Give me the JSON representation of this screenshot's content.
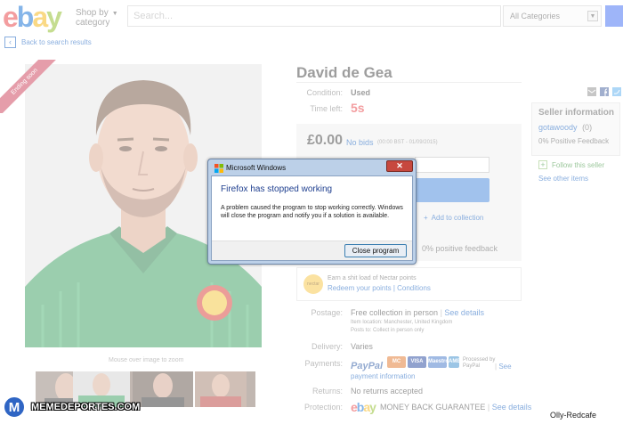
{
  "header": {
    "logo_letters": [
      {
        "char": "e",
        "color": "#e53238"
      },
      {
        "char": "b",
        "color": "#0064d2"
      },
      {
        "char": "a",
        "color": "#f5af02"
      },
      {
        "char": "y",
        "color": "#86b817"
      }
    ],
    "shop_by_line1": "Shop by",
    "shop_by_line2": "category",
    "search_placeholder": "Search...",
    "category_select": "All Categories",
    "back_link": "Back to search results"
  },
  "listing": {
    "ribbon": "Ending soon",
    "title": "David de Gea",
    "mouse_over": "Mouse over image to zoom",
    "condition_label": "Condition:",
    "condition_value": "Used",
    "time_left_label": "Time left:",
    "time_left_value": "5s",
    "price": "£0.00",
    "bids": "No bids",
    "bid_time": "(00:00 BST - 01/09/2015)",
    "add_to_collection": "Add to collection",
    "positive_feedback": "0% positive feedback",
    "nectar_badge": "nectar",
    "nectar_line1": "Earn a shit load of Nectar points",
    "nectar_line2": "Redeem your points | Conditions",
    "postage_label": "Postage:",
    "postage_value": "Free collection in person",
    "postage_link": "See details",
    "item_location": "Item location: Manchester, United Kingdom",
    "posts_to": "Posts to: Collect in person only",
    "delivery_label": "Delivery:",
    "delivery_value": "Varies",
    "payments_label": "Payments:",
    "paypal": "PayPal",
    "payment_cards": [
      {
        "name": "MasterCard",
        "short": "MC",
        "color": "#e07020"
      },
      {
        "name": "VISA",
        "short": "VISA",
        "color": "#1a3e9a"
      },
      {
        "name": "Maestro",
        "short": "Maestro",
        "color": "#3a6fc4"
      },
      {
        "name": "American Express",
        "short": "AMEX",
        "color": "#2f86c8"
      }
    ],
    "processed_by": "Processed by PayPal",
    "payments_see": "See",
    "payment_information": "payment information",
    "returns_label": "Returns:",
    "returns_value": "No returns accepted",
    "protection_label": "Protection:",
    "money_back": "MONEY BACK GUARANTEE",
    "protection_link": "See details"
  },
  "seller": {
    "heading": "Seller information",
    "name": "gotawoody",
    "score": "(0)",
    "feedback": "0% Positive Feedback",
    "follow": "Follow this seller",
    "other_items": "See other items"
  },
  "dialog": {
    "title": "Microsoft Windows",
    "close_glyph": "✕",
    "heading": "Firefox has stopped working",
    "message": "A problem caused the program to stop working correctly. Windows will close the program and notify you if a solution is available.",
    "button": "Close program"
  },
  "watermarks": {
    "left_badge": "M",
    "left_text": "MEMEDEPORTES.COM",
    "right_text": "Olly-Redcafe"
  },
  "colors": {
    "ebay_blue": "#0654ba",
    "ribbon": "#c8344e",
    "time_left": "#e53238",
    "bid_button": "#3c7fd9"
  },
  "icons": [
    "chevron-left-icon",
    "search-icon",
    "email-icon",
    "facebook-icon",
    "twitter-icon",
    "plus-icon",
    "windows-flag-icon",
    "close-icon"
  ]
}
